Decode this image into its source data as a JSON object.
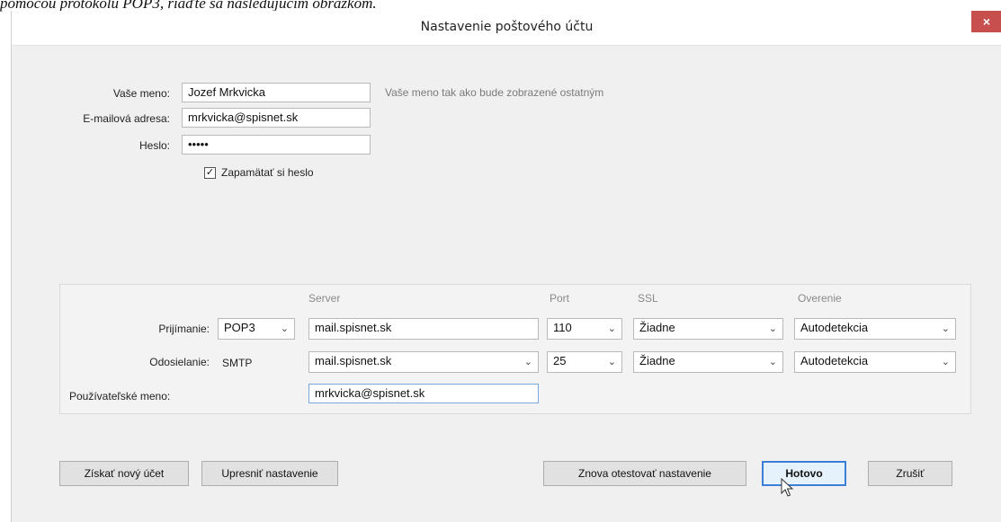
{
  "caption": "pomocou protokolu POP3, riaďte sa nasledujúcim obrázkom.",
  "dialog": {
    "title": "Nastavenie poštového účtu",
    "close_label": "×"
  },
  "account": {
    "name_label": "Vaše meno:",
    "name_value": "Jozef Mrkvicka",
    "name_hint": "Vaše meno tak ako bude zobrazené ostatným",
    "email_label": "E-mailová adresa:",
    "email_value": "mrkvicka@spisnet.sk",
    "password_label": "Heslo:",
    "password_value": "•••••",
    "remember_label": "Zapamätať si heslo",
    "remember_checked": true
  },
  "server": {
    "headers": {
      "server": "Server",
      "port": "Port",
      "ssl": "SSL",
      "auth": "Overenie"
    },
    "incoming": {
      "label": "Prijímanie:",
      "protocol": "POP3",
      "server": "mail.spisnet.sk",
      "port": "110",
      "ssl": "Žiadne",
      "auth": "Autodetekcia"
    },
    "outgoing": {
      "label": "Odosielanie:",
      "protocol": "SMTP",
      "server": "mail.spisnet.sk",
      "port": "25",
      "ssl": "Žiadne",
      "auth": "Autodetekcia"
    },
    "username_label": "Používateľské meno:",
    "username_value": "mrkvicka@spisnet.sk"
  },
  "buttons": {
    "new_account": "Získať nový účet",
    "advanced": "Upresniť nastavenie",
    "retest": "Znova otestovať nastavenie",
    "done": "Hotovo",
    "cancel": "Zrušiť"
  },
  "icons": {
    "check": "✓",
    "dropdown": "⌄"
  }
}
